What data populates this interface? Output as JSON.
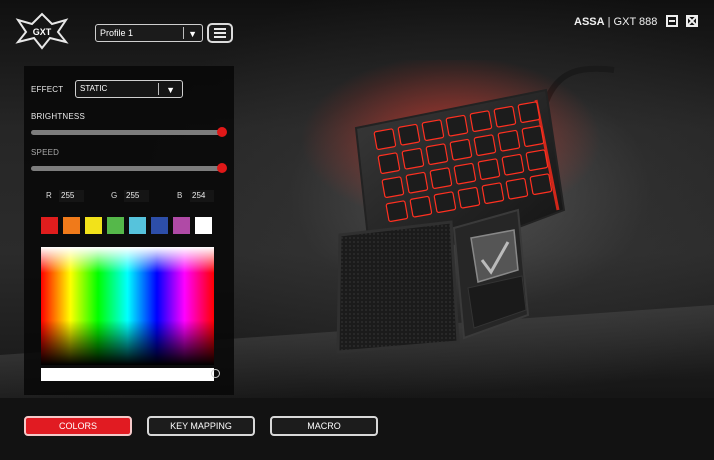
{
  "header": {
    "logo_text": "GXT",
    "profile": {
      "value": "Profile 1"
    },
    "device_name": "ASSA",
    "device_separator": "|",
    "device_model": "GXT 888"
  },
  "effect_panel": {
    "effect_label": "EFFECT",
    "effect_value": "STATIC",
    "brightness_label": "BRIGHTNESS",
    "brightness_level": 1.0,
    "speed_label": "SPEED",
    "speed_level": 1.0,
    "rgb": {
      "r_label": "R",
      "r_value": "255",
      "g_label": "G",
      "g_value": "255",
      "b_label": "B",
      "b_value": "254"
    },
    "swatches": [
      "#e01d1d",
      "#f07a1a",
      "#f2e21a",
      "#55b84a",
      "#56c3dc",
      "#2d4ea8",
      "#b04aa6",
      "#ffffff"
    ]
  },
  "tabs": [
    {
      "label": "COLORS",
      "active": true
    },
    {
      "label": "KEY MAPPING",
      "active": false
    },
    {
      "label": "MACRO",
      "active": false
    }
  ],
  "colors": {
    "accent": "#e11b22",
    "panel": "#080808",
    "key_glow": "#ff2a1a"
  }
}
